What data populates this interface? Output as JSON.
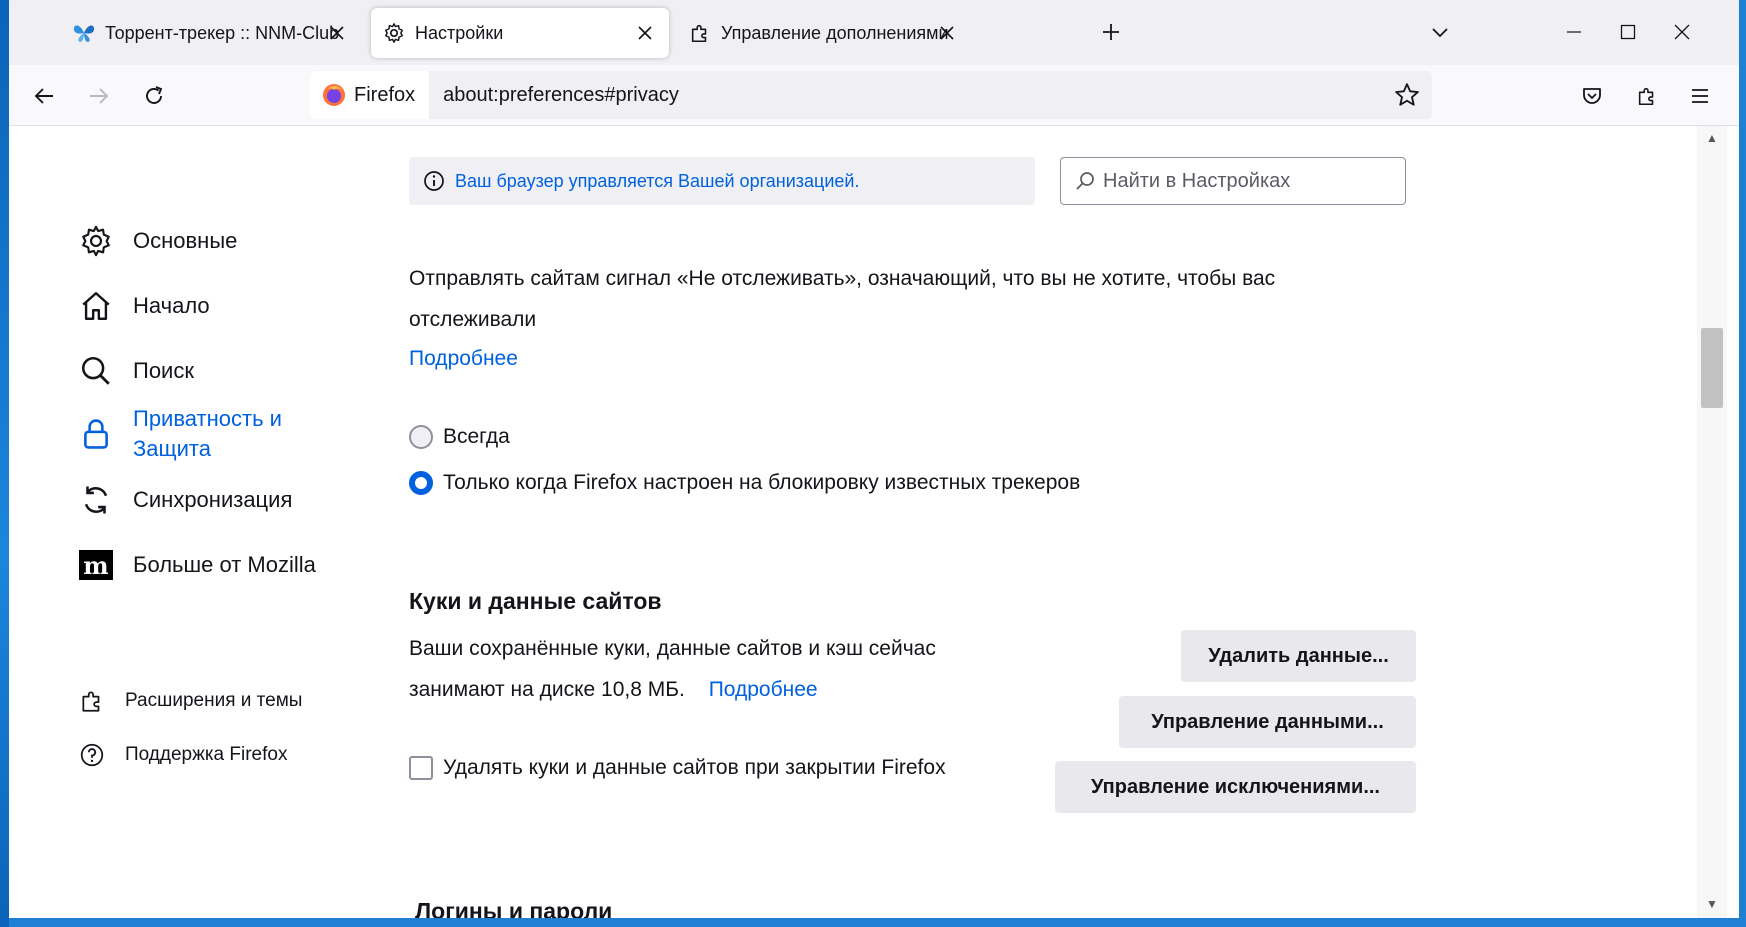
{
  "tabs": [
    {
      "label": "Торрент-трекер :: NNM-Club",
      "icon": "butterfly-icon"
    },
    {
      "label": "Настройки",
      "icon": "gear-icon"
    },
    {
      "label": "Управление дополнениями",
      "icon": "puzzle-icon"
    }
  ],
  "nav": {
    "identity_label": "Firefox",
    "url": "about:preferences#privacy"
  },
  "policy_note": "Ваш браузер управляется Вашей организацией.",
  "search": {
    "placeholder": "Найти в Настройках"
  },
  "sidebar": {
    "categories": [
      {
        "label": "Основные",
        "icon": "gear-icon"
      },
      {
        "label": "Начало",
        "icon": "home-icon"
      },
      {
        "label": "Поиск",
        "icon": "search-icon"
      },
      {
        "label": "Приватность и Защита",
        "icon": "lock-icon",
        "selected": true
      },
      {
        "label": "Синхронизация",
        "icon": "sync-icon"
      },
      {
        "label": "Больше от Mozilla",
        "icon": "mozilla-icon"
      }
    ],
    "footer_links": [
      {
        "label": "Расширения и темы",
        "icon": "puzzle-icon"
      },
      {
        "label": "Поддержка Firefox",
        "icon": "help-icon"
      }
    ]
  },
  "dnt": {
    "description": "Отправлять сайтам сигнал «Не отслеживать», означающий, что вы не хотите, чтобы вас отслеживали",
    "learn_more": "Подробнее",
    "options": [
      {
        "label": "Всегда",
        "checked": false
      },
      {
        "label": "Только когда Firefox настроен на блокировку известных трекеров",
        "checked": true
      }
    ]
  },
  "cookies": {
    "title": "Куки и данные сайтов",
    "description_line1": "Ваши сохранённые куки, данные сайтов и кэш сейчас",
    "description_line2": "занимают на диске 10,8 МБ.",
    "learn_more": "Подробнее",
    "clear_button": "Удалить данные...",
    "manage_data_button": "Управление данными...",
    "manage_exceptions_button": "Управление исключениями...",
    "delete_on_close_label": "Удалять куки и данные сайтов при закрытии Firefox",
    "delete_on_close_checked": false
  },
  "next_section_title": "Логины и пароли",
  "colors": {
    "accent": "#0061e0",
    "tab_strip": "#f0f0f4",
    "button": "#e9e9ed"
  }
}
